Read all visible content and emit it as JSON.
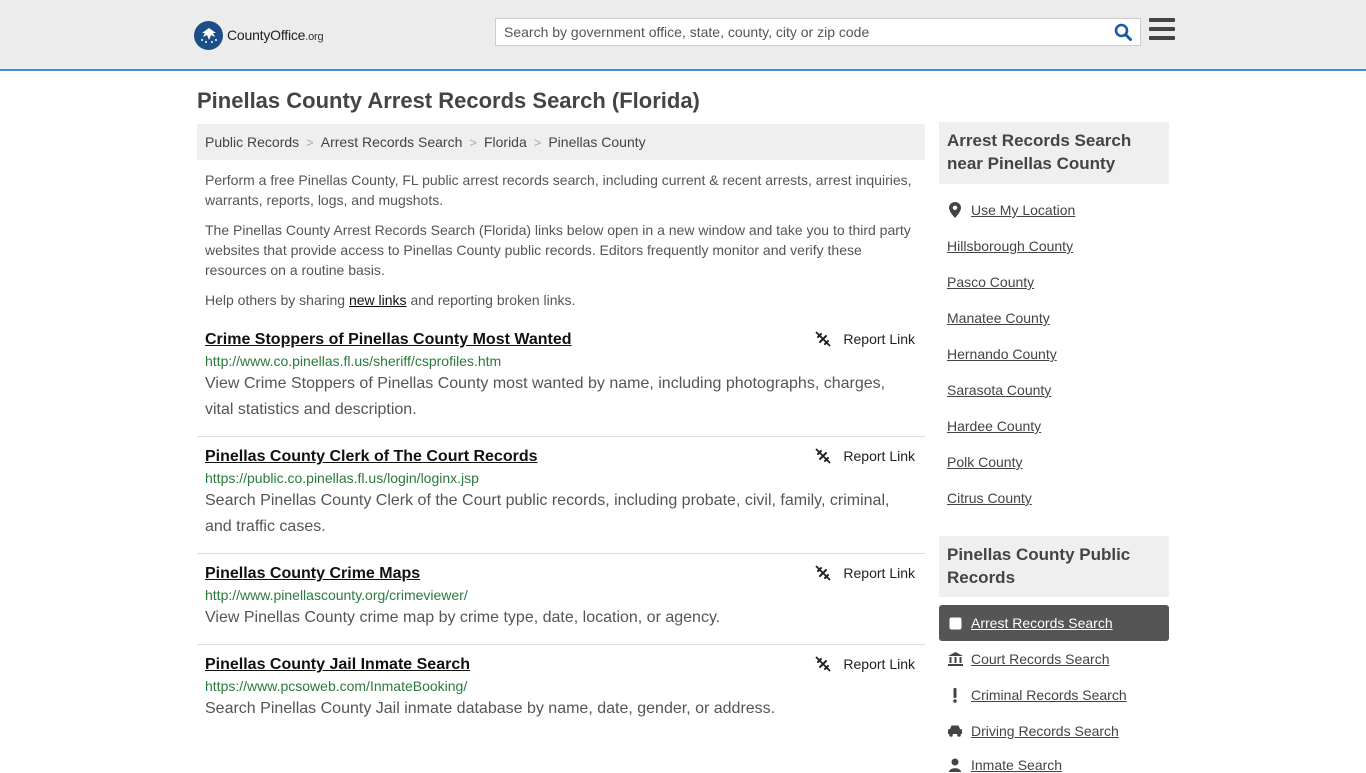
{
  "header": {
    "logo_text": "CountyOffice",
    "logo_suffix": ".org",
    "search_placeholder": "Search by government office, state, county, city or zip code"
  },
  "page_title": "Pinellas County Arrest Records Search (Florida)",
  "breadcrumb": [
    "Public Records",
    "Arrest Records Search",
    "Florida",
    "Pinellas County"
  ],
  "intro": {
    "p1": "Perform a free Pinellas County, FL public arrest records search, including current & recent arrests, arrest inquiries, warrants, reports, logs, and mugshots.",
    "p2": "The Pinellas County Arrest Records Search (Florida) links below open in a new window and take you to third party websites that provide access to Pinellas County public records. Editors frequently monitor and verify these resources on a routine basis.",
    "p3_before": "Help others by sharing ",
    "p3_link": "new links",
    "p3_after": " and reporting broken links."
  },
  "report_label": "Report Link",
  "results": [
    {
      "title": "Crime Stoppers of Pinellas County Most Wanted",
      "url": "http://www.co.pinellas.fl.us/sheriff/csprofiles.htm",
      "desc": "View Crime Stoppers of Pinellas County most wanted by name, including photographs, charges, vital statistics and description."
    },
    {
      "title": "Pinellas County Clerk of The Court Records",
      "url": "https://public.co.pinellas.fl.us/login/loginx.jsp",
      "desc": "Search Pinellas County Clerk of the Court public records, including probate, civil, family, criminal, and traffic cases."
    },
    {
      "title": "Pinellas County Crime Maps",
      "url": "http://www.pinellascounty.org/crimeviewer/",
      "desc": "View Pinellas County crime map by crime type, date, location, or agency."
    },
    {
      "title": "Pinellas County Jail Inmate Search",
      "url": "https://www.pcsoweb.com/InmateBooking/",
      "desc": "Search Pinellas County Jail inmate database by name, date, gender, or address."
    }
  ],
  "sidebar": {
    "nearby_title": "Arrest Records Search near Pinellas County",
    "use_location": "Use My Location",
    "nearby": [
      "Hillsborough County",
      "Pasco County",
      "Manatee County",
      "Hernando County",
      "Sarasota County",
      "Hardee County",
      "Polk County",
      "Citrus County"
    ],
    "records_title": "Pinellas County Public Records",
    "records": [
      {
        "label": "Arrest Records Search",
        "icon": "square-icon",
        "active": true
      },
      {
        "label": "Court Records Search",
        "icon": "courthouse-icon"
      },
      {
        "label": "Criminal Records Search",
        "icon": "exclamation-icon"
      },
      {
        "label": "Driving Records Search",
        "icon": "car-icon"
      },
      {
        "label": "Inmate Search",
        "icon": "person-icon"
      }
    ]
  },
  "colors": {
    "header_bg": "#ececec",
    "header_border": "#4a8bc9",
    "url_green": "#2a7a3b",
    "active_bg": "#555555",
    "logo_blue": "#1c4f8a"
  }
}
